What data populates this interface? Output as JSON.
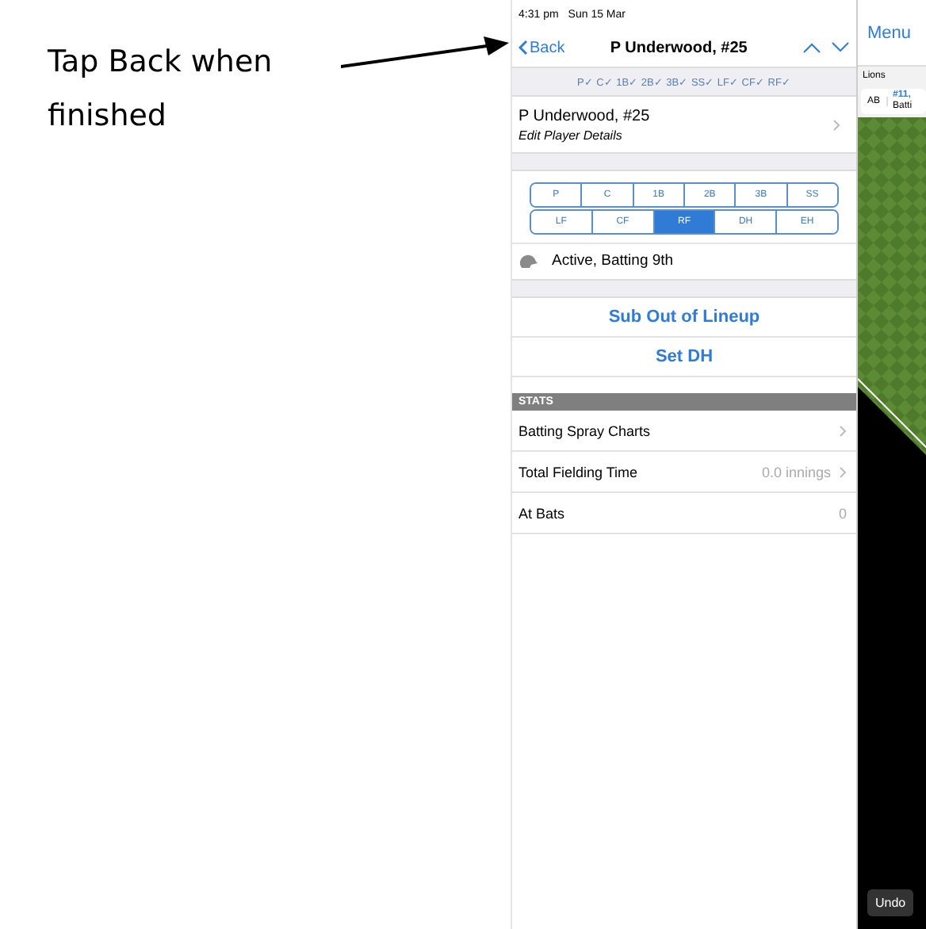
{
  "annotation": {
    "text": "Tap Back when finished"
  },
  "status_bar": {
    "time": "4:31 pm",
    "date": "Sun 15 Mar"
  },
  "nav": {
    "back": "Back",
    "title": "P Underwood, #25"
  },
  "positions_played": "P✓ C✓ 1B✓ 2B✓ 3B✓ SS✓ LF✓ CF✓ RF✓",
  "player": {
    "name": "P Underwood, #25",
    "subtitle": "Edit Player Details"
  },
  "position_rows": [
    [
      {
        "label": "P",
        "selected": false
      },
      {
        "label": "C",
        "selected": false
      },
      {
        "label": "1B",
        "selected": false
      },
      {
        "label": "2B",
        "selected": false
      },
      {
        "label": "3B",
        "selected": false
      },
      {
        "label": "SS",
        "selected": false
      }
    ],
    [
      {
        "label": "LF",
        "selected": false
      },
      {
        "label": "CF",
        "selected": false
      },
      {
        "label": "RF",
        "selected": true
      },
      {
        "label": "DH",
        "selected": false
      },
      {
        "label": "EH",
        "selected": false
      }
    ]
  ],
  "status": "Active, Batting 9th",
  "actions": [
    "Sub Out of Lineup",
    "Set DH"
  ],
  "stats": {
    "header": "STATS",
    "rows": [
      {
        "label": "Batting Spray Charts",
        "value": null,
        "chevron": true
      },
      {
        "label": "Total Fielding Time",
        "value": "0.0 innings",
        "chevron": true
      },
      {
        "label": "At Bats",
        "value": "0",
        "chevron": false
      }
    ]
  },
  "right_panel": {
    "menu": "Menu",
    "team": "Lions",
    "at_bat": {
      "tag": "AB",
      "number": "#11,",
      "line": "Batti"
    },
    "undo": "Undo"
  }
}
